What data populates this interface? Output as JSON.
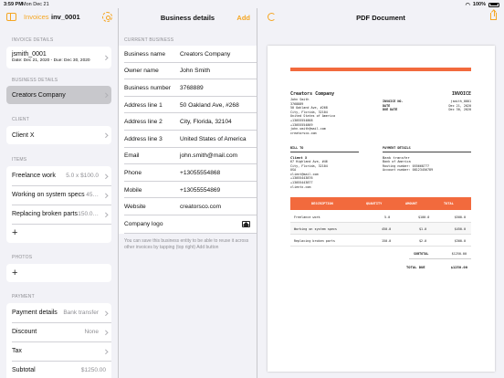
{
  "status": {
    "time": "3:59 PM",
    "date": "Mon Dec 21",
    "battery": "100%"
  },
  "sidebar": {
    "back_label": "Invoices",
    "title": "inv_0001",
    "invoice_details_header": "INVOICE DETAILS",
    "invoice_name": "jsmith_0001",
    "invoice_dates": "Date: Dec 21, 2020 - Due: Dec 30, 2020",
    "business_details_header": "BUSINESS DETAILS",
    "business_name": "Creators Company",
    "client_header": "CLIENT",
    "client_name": "Client X",
    "items_header": "ITEMS",
    "items": [
      {
        "name": "Freelance work",
        "value": "5.0 x $100.0"
      },
      {
        "name": "Working on system specs",
        "value": "45…"
      },
      {
        "name": "Replacing broken parts",
        "value": "150.0…"
      }
    ],
    "photos_header": "PHOTOS",
    "payment_header": "PAYMENT",
    "payment_rows": [
      {
        "label": "Payment details",
        "value": "Bank transfer"
      },
      {
        "label": "Discount",
        "value": "None"
      },
      {
        "label": "Tax",
        "value": ""
      },
      {
        "label": "Subtotal",
        "value": "$1250.00"
      }
    ]
  },
  "business": {
    "title": "Business details",
    "add_label": "Add",
    "section_header": "CURRENT BUSINESS",
    "fields": [
      {
        "label": "Business name",
        "value": "Creators Company"
      },
      {
        "label": "Owner name",
        "value": "John Smith"
      },
      {
        "label": "Business number",
        "value": "3768889"
      },
      {
        "label": "Address line 1",
        "value": "50 Oakland Ave, #268"
      },
      {
        "label": "Address line 2",
        "value": "City, Florida, 32104"
      },
      {
        "label": "Address line 3",
        "value": "United States of America"
      },
      {
        "label": "Email",
        "value": "john.smith@mail.com"
      },
      {
        "label": "Phone",
        "value": "+13055554868"
      },
      {
        "label": "Mobile",
        "value": "+13055554869"
      },
      {
        "label": "Website",
        "value": "creatorsco.com"
      }
    ],
    "logo_label": "Company logo",
    "note": "You can save this business entity to be able to reuse it across other invoices by tapping (top right) Add button"
  },
  "pdf": {
    "title": "PDF Document",
    "company": "Creators Company",
    "company_lines": [
      "John Smith",
      "3768889",
      "50 Oakland Ave, #268",
      "City, Florida, 32104",
      "United States of America",
      "+13055554868",
      "+13055554869",
      "john.smith@mail.com",
      "creatorsco.com"
    ],
    "invoice_label": "INVOICE",
    "meta": [
      {
        "k": "INVOICE NO.",
        "v": "jsmith_0001"
      },
      {
        "k": "DATE",
        "v": "Dec 21, 2020"
      },
      {
        "k": "DUE DATE",
        "v": "Dec 30, 2020"
      }
    ],
    "bill_to_label": "BILL TO",
    "client": "Client X",
    "client_lines": [
      "67 Highland Ave, #46",
      "City, Florida, 32104",
      "USA",
      "client@mail.com",
      "+13055443876",
      "+13055443877",
      "clientx.com"
    ],
    "payment_label": "PAYMENT DETAILS",
    "payment_method": "Bank transfer",
    "payment_lines": [
      "Bank of America",
      "Routing number: 055668777",
      "Account number: 08123456789"
    ],
    "table_headers": [
      "DESCRIPTION",
      "QUANTITY",
      "AMOUNT",
      "TOTAL"
    ],
    "rows": [
      {
        "desc": "Freelance work",
        "qty": "5.0",
        "amount": "$100.0",
        "total": "$500.0"
      },
      {
        "desc": "Working on system specs",
        "qty": "450.0",
        "amount": "$1.0",
        "total": "$450.0"
      },
      {
        "desc": "Replacing broken parts",
        "qty": "150.0",
        "amount": "$2.0",
        "total": "$300.0"
      }
    ],
    "subtotal_label": "SUBTOTAL",
    "subtotal": "$1250.00",
    "total_label": "TOTAL DUE",
    "total": "$1250.00"
  }
}
